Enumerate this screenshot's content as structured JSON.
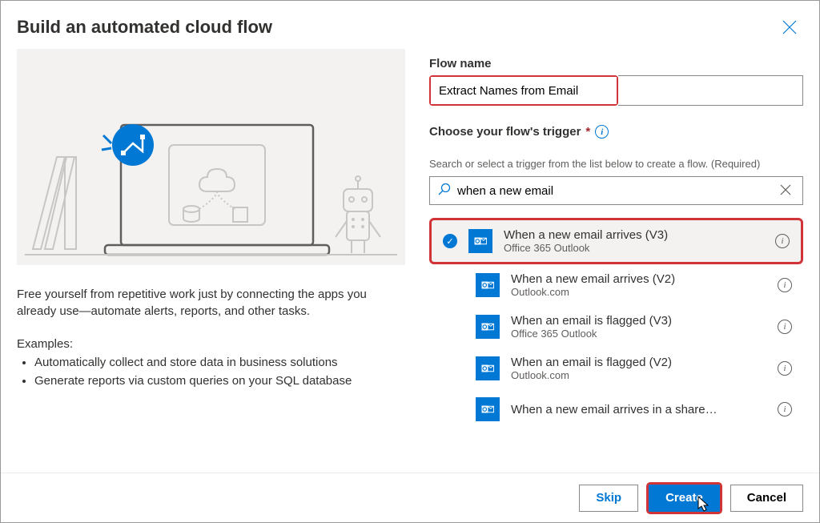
{
  "header": {
    "title": "Build an automated cloud flow"
  },
  "left": {
    "description": "Free yourself from repetitive work just by connecting the apps you already use—automate alerts, reports, and other tasks.",
    "examplesTitle": "Examples:",
    "examples": [
      "Automatically collect and store data in business solutions",
      "Generate reports via custom queries on your SQL database"
    ]
  },
  "form": {
    "flowNameLabel": "Flow name",
    "flowNameValue": "Extract Names from Email",
    "triggerLabel": "Choose your flow's trigger",
    "requiredMark": "*",
    "helperText": "Search or select a trigger from the list below to create a flow. (Required)",
    "searchValue": "when a new email"
  },
  "triggers": [
    {
      "name": "When a new email arrives (V3)",
      "connector": "Office 365 Outlook",
      "selected": true
    },
    {
      "name": "When a new email arrives (V2)",
      "connector": "Outlook.com",
      "selected": false
    },
    {
      "name": "When an email is flagged (V3)",
      "connector": "Office 365 Outlook",
      "selected": false
    },
    {
      "name": "When an email is flagged (V2)",
      "connector": "Outlook.com",
      "selected": false
    },
    {
      "name": "When a new email arrives in a share…",
      "connector": "",
      "selected": false
    }
  ],
  "footer": {
    "skip": "Skip",
    "create": "Create",
    "cancel": "Cancel"
  }
}
